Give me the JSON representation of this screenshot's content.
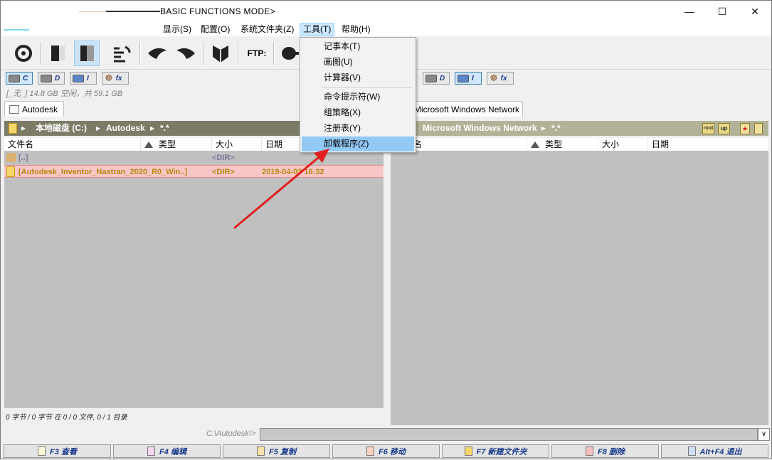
{
  "window": {
    "title": "BASIC FUNCTIONS MODE>",
    "controls": {
      "minimize": "—",
      "maximize": "☐",
      "close": "✕"
    }
  },
  "menu": [
    {
      "label": "显示(S)"
    },
    {
      "label": "配置(O)"
    },
    {
      "label": "系统文件夹(Z)"
    },
    {
      "label": "工具(T)",
      "active": true
    },
    {
      "label": "帮助(H)"
    }
  ],
  "toolbar": {
    "ftp_label": "FTP:"
  },
  "tools_menu": {
    "items": [
      {
        "label": "记事本(T)"
      },
      {
        "label": "画图(U)"
      },
      {
        "label": "计算器(V)"
      },
      {
        "label": "命令提示符(W)"
      },
      {
        "label": "组策略(X)"
      },
      {
        "label": "注册表(Y)"
      },
      {
        "label": "卸载程序(Z)",
        "highlighted": true
      }
    ]
  },
  "left_panel": {
    "drives": [
      {
        "label": "C",
        "selected": true
      },
      {
        "label": "D"
      },
      {
        "label": "I"
      },
      {
        "label": "fx"
      }
    ],
    "drive_info": "[_无_] 14.8 GB 空闲，共 59.1 GB",
    "tab": "Autodesk",
    "path": [
      "本地磁盘 (C:)",
      "Autodesk",
      "*.*"
    ],
    "columns": {
      "name": "文件名",
      "type": "类型",
      "size": "大小",
      "date": "日期"
    },
    "rows": [
      {
        "name": "[..]",
        "size": "<DIR>",
        "date": ""
      },
      {
        "name": "[Autodesk_Inventor_Nastran_2020_R0_Win..]",
        "size": "<DIR>",
        "date": "2019-04-03 16:32"
      }
    ],
    "status": "0 字节 / 0 字节 在 0 / 0 文件, 0 / 1 目录"
  },
  "right_panel": {
    "drives": [
      {
        "label": "D"
      },
      {
        "label": "I",
        "selected": true
      },
      {
        "label": "fx"
      }
    ],
    "tab": "Microsoft Windows Network",
    "path": [
      "Microsoft Windows Network",
      "*.*"
    ],
    "path_buttons": [
      "root",
      "up"
    ],
    "columns": {
      "name": "名",
      "type": "类型",
      "size": "大小",
      "date": "日期"
    }
  },
  "command_line": {
    "path": "C:\\Autodesk\\>",
    "value": ""
  },
  "function_keys": [
    {
      "label": "F3 查看"
    },
    {
      "label": "F4 编辑"
    },
    {
      "label": "F5 复制"
    },
    {
      "label": "F6 移动"
    },
    {
      "label": "F7 新建文件夹"
    },
    {
      "label": "F8 删除"
    },
    {
      "label": "Alt+F4 退出"
    }
  ],
  "colors": {
    "path_bar": "#7b7b66",
    "list_bg": "#c0c0c0",
    "selected_row": "#f7c7c7",
    "folder_text": "#b8860b",
    "menu_highlight": "#91c9f7",
    "annotation_arrow": "#e02020"
  }
}
